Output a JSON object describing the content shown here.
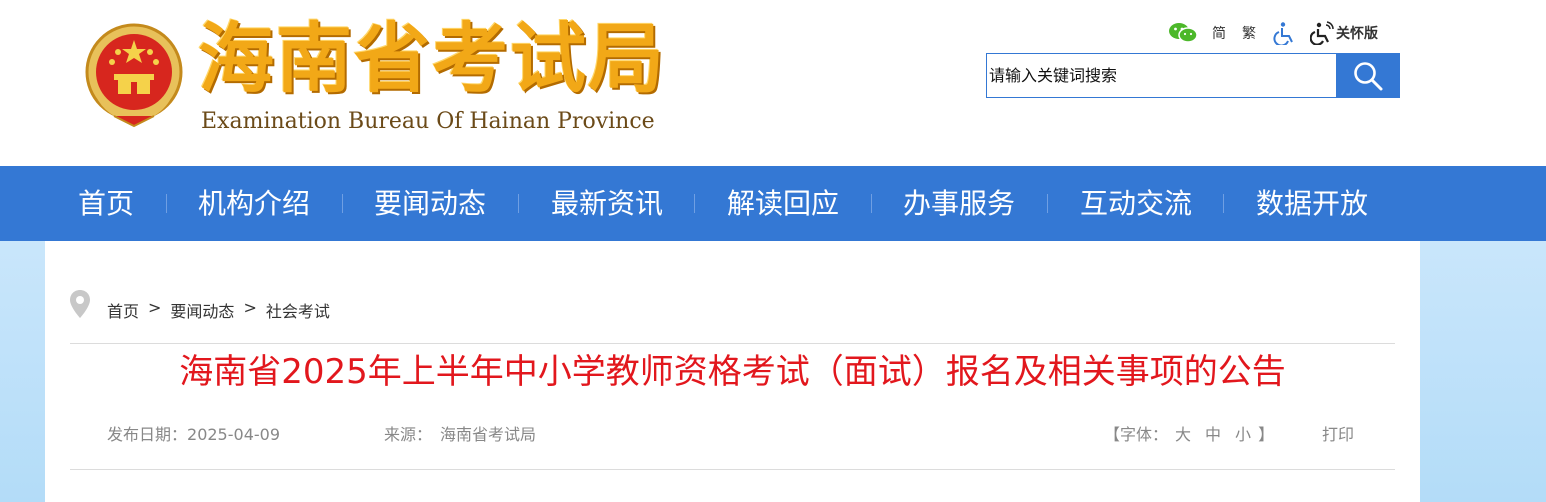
{
  "header": {
    "logo_cn": "海南省考试局",
    "logo_en": "Examination Bureau Of Hainan Province",
    "tools": {
      "simplified": "简",
      "traditional": "繁",
      "care_mode": "关怀版"
    },
    "search": {
      "placeholder": "请输入关键词搜索"
    }
  },
  "nav": [
    "首页",
    "机构介绍",
    "要闻动态",
    "最新资讯",
    "解读回应",
    "办事服务",
    "互动交流",
    "数据开放"
  ],
  "breadcrumb": {
    "home": "首页",
    "sep": ">",
    "level1": "要闻动态",
    "level2": "社会考试"
  },
  "article": {
    "title": "海南省2025年上半年中小学教师资格考试（面试）报名及相关事项的公告",
    "date_label": "发布日期：",
    "date": "2025-04-09",
    "source_label": "来源：",
    "source": "海南省考试局",
    "font_open": "【字体：",
    "font_large": "大",
    "font_medium": "中",
    "font_small": "小",
    "font_close": "】",
    "print": "打印"
  },
  "colors": {
    "brand_blue": "#3478d4",
    "title_red": "#e2171d",
    "logo_gold": "#f2a817"
  },
  "icons": [
    "emblem",
    "wechat-icon",
    "accessibility-icon",
    "care-mode-icon",
    "search-icon",
    "location-pin-icon"
  ]
}
